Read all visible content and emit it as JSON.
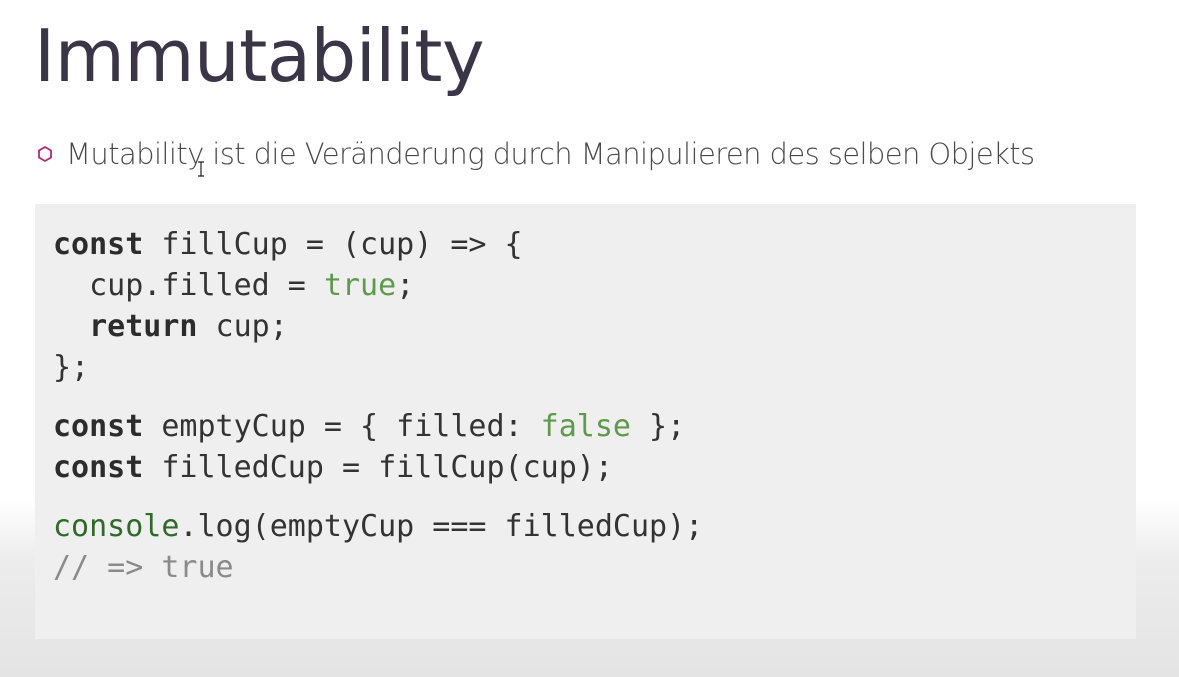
{
  "slide": {
    "title": "Immutability",
    "bullet": "Mutability ist die Veränderung durch Manipulieren des selben Objekts"
  },
  "code": {
    "l1_kw": "const",
    "l1_rest": " fillCup = (cup) => {",
    "l2_pre": "  cup.filled = ",
    "l2_lit": "true",
    "l2_post": ";",
    "l3_pre": "  ",
    "l3_kw": "return",
    "l3_rest": " cup;",
    "l4": "};",
    "l5_kw": "const",
    "l5_pre": " emptyCup = { filled: ",
    "l5_lit": "false",
    "l5_post": " };",
    "l6_kw": "const",
    "l6_rest": " filledCup = fillCup(cup);",
    "l7_fn": "console",
    "l7_rest": ".log(emptyCup === filledCup);",
    "l8_comment": "// => true"
  },
  "colors": {
    "title": "#3b3548",
    "bullet_icon": "#b0287a",
    "literal": "#5d9a4a",
    "comment": "#8a8a8a"
  },
  "icons": {
    "bullet": "hexagon-outline-icon",
    "cursor": "text-cursor-icon"
  }
}
